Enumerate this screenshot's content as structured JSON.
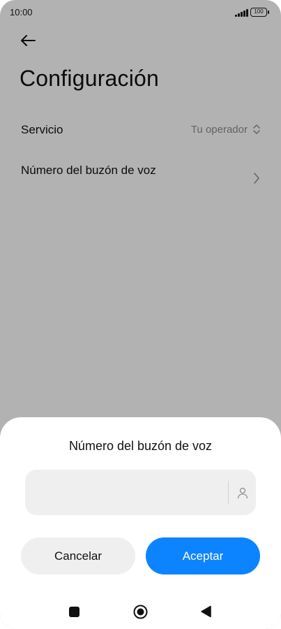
{
  "status_bar": {
    "time": "10:00",
    "battery": "100"
  },
  "page": {
    "title": "Configuración",
    "rows": [
      {
        "label": "Servicio",
        "value": "Tu operador"
      },
      {
        "label": "Número del buzón de voz",
        "value": ""
      }
    ]
  },
  "dialog": {
    "title": "Número del buzón de voz",
    "input_value": "",
    "cancel_label": "Cancelar",
    "accept_label": "Aceptar"
  },
  "colors": {
    "accent": "#0d84ff",
    "overlay": "rgba(0,0,0,0.30)"
  },
  "icons": {
    "back": "back-arrow-icon",
    "service_selector": "up-down-chevron-icon",
    "row_chevron": "chevron-right-icon",
    "contact": "contact-person-icon",
    "nav_recent": "square-icon",
    "nav_home": "circle-icon",
    "nav_back": "triangle-back-icon"
  }
}
